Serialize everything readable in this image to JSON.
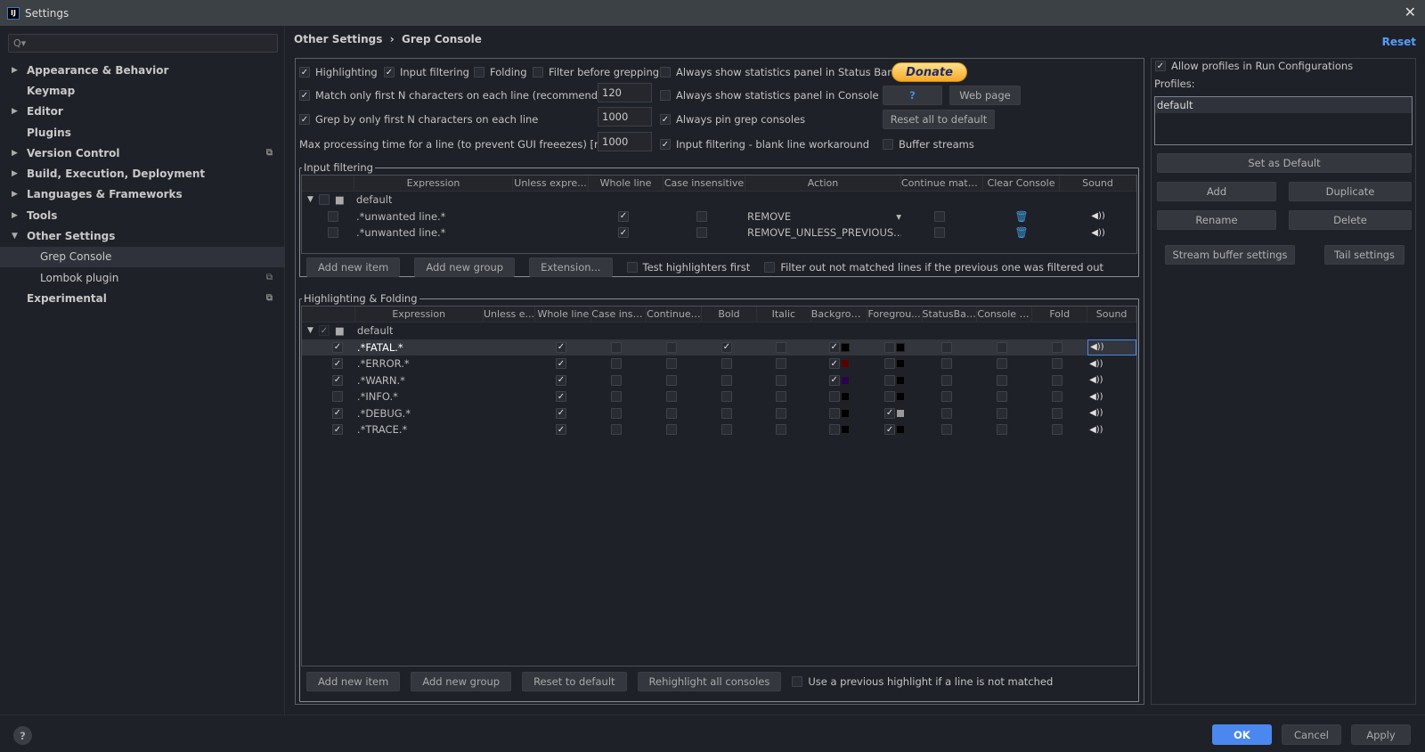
{
  "window": {
    "title": "Settings",
    "close": "✕"
  },
  "sidebar": {
    "search_placeholder": "Q▾",
    "items": [
      {
        "label": "Appearance & Behavior",
        "arrow": "▶",
        "sub": false
      },
      {
        "label": "Keymap",
        "arrow": "",
        "sub": false
      },
      {
        "label": "Editor",
        "arrow": "▶",
        "sub": false
      },
      {
        "label": "Plugins",
        "arrow": "",
        "sub": false
      },
      {
        "label": "Version Control",
        "arrow": "▶",
        "sub": false,
        "ext": true
      },
      {
        "label": "Build, Execution, Deployment",
        "arrow": "▶",
        "sub": false
      },
      {
        "label": "Languages & Frameworks",
        "arrow": "▶",
        "sub": false
      },
      {
        "label": "Tools",
        "arrow": "▶",
        "sub": false
      },
      {
        "label": "Other Settings",
        "arrow": "▼",
        "sub": false
      },
      {
        "label": "Grep Console",
        "arrow": "",
        "sub": true,
        "selected": true
      },
      {
        "label": "Lombok plugin",
        "arrow": "",
        "sub": true,
        "ext": true
      },
      {
        "label": "Experimental",
        "arrow": "",
        "sub": false,
        "ext": true
      }
    ]
  },
  "breadcrumb": {
    "parent": "Other Settings",
    "sep": "›",
    "current": "Grep Console"
  },
  "reset": "Reset",
  "options": {
    "highlighting": {
      "label": "Highlighting",
      "checked": true
    },
    "input_filtering": {
      "label": "Input filtering",
      "checked": true
    },
    "folding": {
      "label": "Folding",
      "checked": false
    },
    "filter_before": {
      "label": "Filter before grepping",
      "checked": false
    },
    "stats_status": {
      "label": "Always show statistics panel in Status Bar",
      "checked": false
    },
    "match_first": {
      "label": "Match only first N characters on each line (recommended)",
      "checked": true,
      "value": "120"
    },
    "stats_console": {
      "label": "Always show statistics panel in Console",
      "checked": false
    },
    "grep_first": {
      "label": "Grep by only first N characters on each line",
      "checked": true,
      "value": "1000"
    },
    "pin": {
      "label": "Always pin grep consoles",
      "checked": true
    },
    "max_time": {
      "label": "Max processing time for a line (to prevent GUI freeezes) [ms]",
      "value": "1000"
    },
    "blank_line": {
      "label": "Input filtering - blank line workaround",
      "checked": true
    },
    "buffer": {
      "label": "Buffer streams",
      "checked": false
    },
    "donate": "Donate",
    "help": "?",
    "web_page": "Web page",
    "reset_all": "Reset all to default"
  },
  "input_filtering": {
    "title": "Input filtering",
    "columns": [
      "",
      "Expression",
      "Unless expre...",
      "Whole line",
      "Case insensitive",
      "Action",
      "Continue matc...",
      "Clear Console",
      "Sound"
    ],
    "group": "default",
    "rows": [
      {
        "enabled": false,
        "expression": ".*unwanted line.*",
        "whole_line": true,
        "case_insensitive": false,
        "action": "REMOVE",
        "continue": false
      },
      {
        "enabled": false,
        "expression": ".*unwanted line.*",
        "whole_line": true,
        "case_insensitive": false,
        "action": "REMOVE_UNLESS_PREVIOUS...",
        "continue": false
      }
    ],
    "buttons": [
      "Add new item",
      "Add new group",
      "Extension..."
    ],
    "test_first": {
      "label": "Test highlighters first",
      "checked": false
    },
    "filter_out": {
      "label": "Filter out not matched lines if the previous one was filtered out",
      "checked": false
    }
  },
  "highlighting": {
    "title": "Highlighting & Folding",
    "columns": [
      "",
      "Expression",
      "Unless e...",
      "Whole line",
      "Case inse...",
      "Continue ...",
      "Bold",
      "Italic",
      "Backgrou...",
      "Foregrou...",
      "StatusBar...",
      "Console c...",
      "Fold",
      "Sound"
    ],
    "group": "default",
    "rows": [
      {
        "enabled": true,
        "expression": ".*FATAL.*",
        "whole": true,
        "bold": true,
        "bg": true,
        "bg_color": "#000000",
        "fg": false,
        "fg_color": "#000000",
        "selected": true
      },
      {
        "enabled": true,
        "expression": ".*ERROR.*",
        "whole": true,
        "bold": false,
        "bg": true,
        "bg_color": "#5a0000",
        "fg": false,
        "fg_color": "#000000"
      },
      {
        "enabled": true,
        "expression": ".*WARN.*",
        "whole": true,
        "bold": false,
        "bg": true,
        "bg_color": "#2a0050",
        "fg": false,
        "fg_color": "#000000"
      },
      {
        "enabled": false,
        "expression": ".*INFO.*",
        "whole": true,
        "bold": false,
        "bg": false,
        "bg_color": "#000000",
        "fg": false,
        "fg_color": "#000000"
      },
      {
        "enabled": true,
        "expression": ".*DEBUG.*",
        "whole": true,
        "bold": false,
        "bg": false,
        "bg_color": "#000000",
        "fg": true,
        "fg_color": "#9a9a9a"
      },
      {
        "enabled": true,
        "expression": ".*TRACE.*",
        "whole": true,
        "bold": false,
        "bg": false,
        "bg_color": "#000000",
        "fg": true,
        "fg_color": "#000000"
      }
    ],
    "buttons": [
      "Add new item",
      "Add new group",
      "Reset to default",
      "Rehighlight all consoles"
    ],
    "use_previous": {
      "label": "Use a previous highlight if a line is not matched",
      "checked": false
    }
  },
  "profiles": {
    "allow": {
      "label": "Allow profiles in Run Configurations",
      "checked": true
    },
    "label": "Profiles:",
    "items": [
      "default"
    ],
    "set_default": "Set as Default",
    "add": "Add",
    "duplicate": "Duplicate",
    "rename": "Rename",
    "delete": "Delete",
    "stream_buffer": "Stream buffer settings",
    "tail": "Tail settings"
  },
  "footer": {
    "help": "?",
    "ok": "OK",
    "cancel": "Cancel",
    "apply": "Apply"
  },
  "colors": {
    "accent": "#4a88f0",
    "link": "#589df6"
  }
}
